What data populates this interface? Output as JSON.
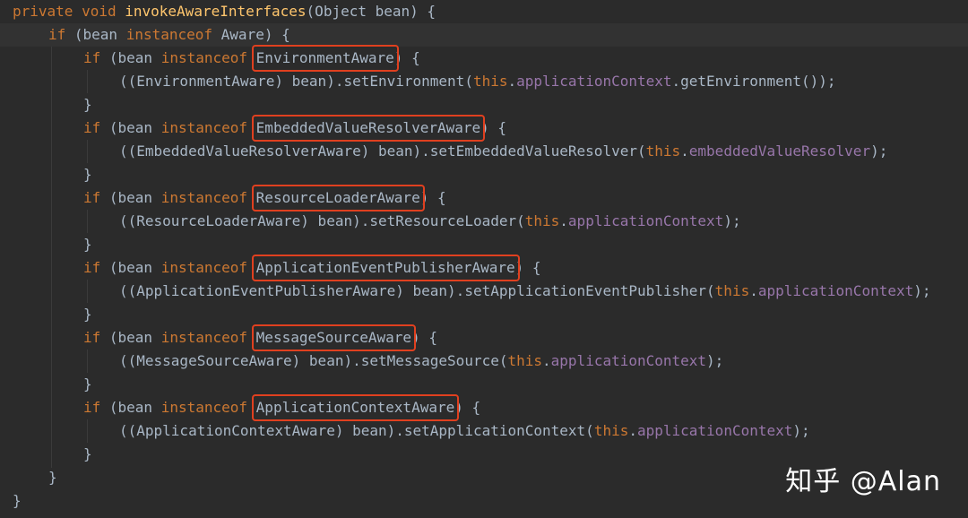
{
  "code": {
    "method_header": {
      "modifier1": "private",
      "modifier2": "void",
      "name": "invokeAwareInterfaces",
      "params": "(Object bean) {"
    },
    "outer_if": {
      "kw_if": "if",
      "open": " (bean ",
      "kw_instanceof": "instanceof",
      "rest": " Aware) {"
    },
    "blocks": [
      {
        "type": "EnvironmentAware",
        "call_prefix": "((EnvironmentAware) bean).setEnvironment(",
        "kw_this": "this",
        "field": "applicationContext",
        "call_suffix": ".getEnvironment());"
      },
      {
        "type": "EmbeddedValueResolverAware",
        "call_prefix": "((EmbeddedValueResolverAware) bean).setEmbeddedValueResolver(",
        "kw_this": "this",
        "field": "embeddedValueResolver",
        "call_suffix": ");"
      },
      {
        "type": "ResourceLoaderAware",
        "call_prefix": "((ResourceLoaderAware) bean).setResourceLoader(",
        "kw_this": "this",
        "field": "applicationContext",
        "call_suffix": ");"
      },
      {
        "type": "ApplicationEventPublisherAware",
        "call_prefix": "((ApplicationEventPublisherAware) bean).setApplicationEventPublisher(",
        "kw_this": "this",
        "field": "applicationContext",
        "call_suffix": ");"
      },
      {
        "type": "MessageSourceAware",
        "call_prefix": "((MessageSourceAware) bean).setMessageSource(",
        "kw_this": "this",
        "field": "applicationContext",
        "call_suffix": ");"
      },
      {
        "type": "ApplicationContextAware",
        "call_prefix": "((ApplicationContextAware) bean).setApplicationContext(",
        "kw_this": "this",
        "field": "applicationContext",
        "call_suffix": ");"
      }
    ],
    "inner_if": {
      "kw_if": "if",
      "open": " (bean ",
      "kw_instanceof": "instanceof",
      "brace": ") {"
    },
    "close_brace": "}"
  },
  "watermark": "知乎 @Alan",
  "colors": {
    "background": "#2b2b2b",
    "keyword": "#cc7832",
    "method": "#ffc66d",
    "field": "#9876aa",
    "text": "#a9b7c6",
    "highlight_box": "#e0401f"
  }
}
